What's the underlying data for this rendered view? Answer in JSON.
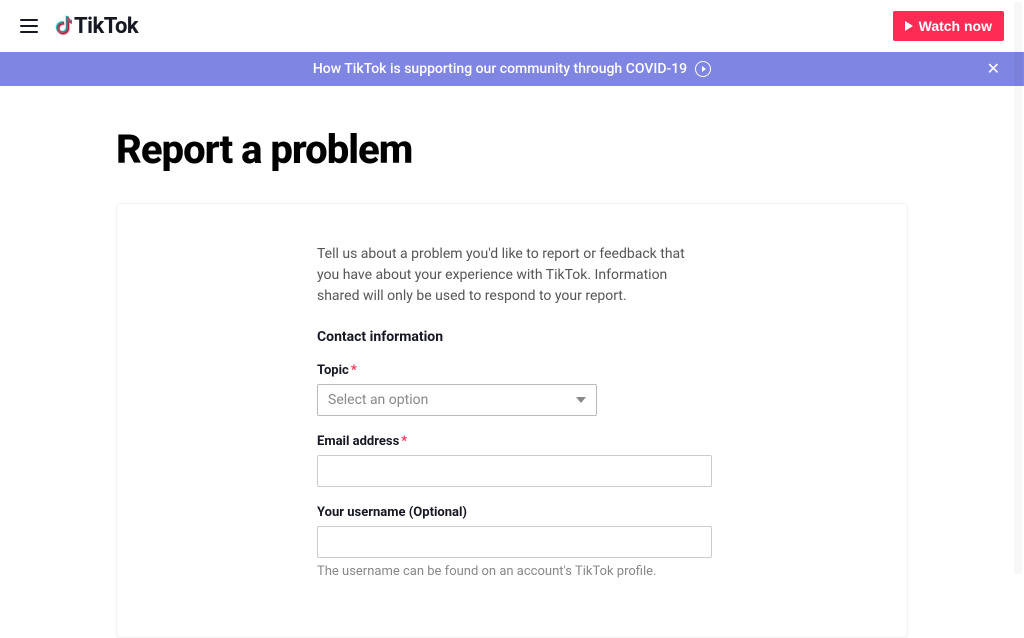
{
  "header": {
    "logo_text": "TikTok",
    "watch_now": "Watch now"
  },
  "banner": {
    "text": "How TikTok is supporting our community through COVID-19"
  },
  "page": {
    "title": "Report a problem",
    "intro": "Tell us about a problem you'd like to report or feedback that you have about your experience with TikTok. Information shared will only be used to respond to your report.",
    "section_title": "Contact information"
  },
  "form": {
    "topic_label": "Topic",
    "topic_placeholder": "Select an option",
    "email_label": "Email address",
    "username_label": "Your username (Optional)",
    "username_hint": "The username can be found on an account's TikTok profile.",
    "required_mark": "*"
  }
}
